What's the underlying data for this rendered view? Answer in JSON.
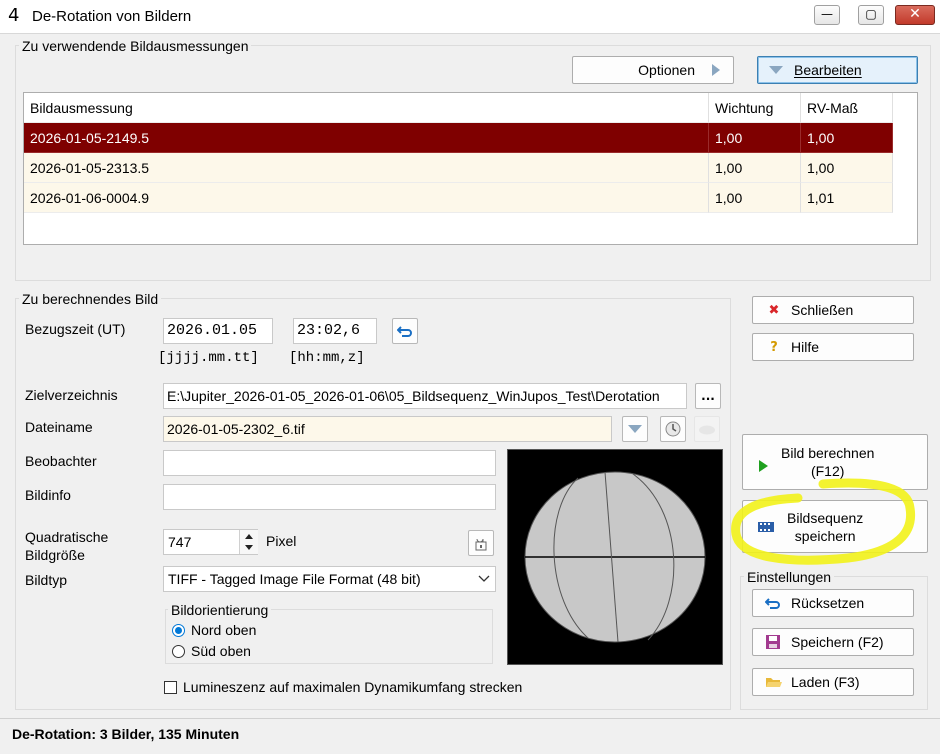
{
  "window": {
    "title": "De-Rotation von Bildern",
    "icon_glyph": "4",
    "minimize_glyph": "—",
    "maximize_glyph": "▢",
    "close_glyph": "✕"
  },
  "measurements": {
    "group_label": "Zu verwendende Bildausmessungen",
    "options_label": "Optionen",
    "edit_label": "Bearbeiten",
    "columns": [
      "Bildausmessung",
      "Wichtung",
      "RV-Maß"
    ],
    "rows": [
      {
        "name": "2026-01-05-2149.5",
        "weight": "1,00",
        "rv": "1,00",
        "selected": true
      },
      {
        "name": "2026-01-05-2313.5",
        "weight": "1,00",
        "rv": "1,00",
        "selected": false
      },
      {
        "name": "2026-01-06-0004.9",
        "weight": "1,00",
        "rv": "1,01",
        "selected": false
      }
    ]
  },
  "image": {
    "group_label": "Zu berechnendes Bild",
    "ref_time_label": "Bezugszeit (UT)",
    "date_value": "2026.01.05",
    "time_value": "23:02,6",
    "date_format": "[jjjj.mm.tt]",
    "time_format": "[hh:mm,z]",
    "target_dir_label": "Zielverzeichnis",
    "target_dir_value": "E:\\Jupiter_2026-01-05_2026-01-06\\05_Bildsequenz_WinJupos_Test\\Derotation",
    "browse_label": "...",
    "filename_label": "Dateiname",
    "filename_value": "2026-01-05-2302_6.tif",
    "observer_label": "Beobachter",
    "observer_value": "",
    "info_label": "Bildinfo",
    "info_value": "",
    "size_label_1": "Quadratische",
    "size_label_2": "Bildgröße",
    "size_value": "747",
    "size_unit": "Pixel",
    "type_label": "Bildtyp",
    "type_value": "TIFF - Tagged Image File Format (48 bit)",
    "orientation_label": "Bildorientierung",
    "north_label": "Nord oben",
    "south_label": "Süd oben",
    "orientation_selected": "north",
    "luminescence_label": "Lumineszenz auf maximalen Dynamikumfang strecken",
    "luminescence_checked": false
  },
  "actions": {
    "close_label": "Schließen",
    "help_label": "Hilfe",
    "compute_label_1": "Bild berechnen",
    "compute_label_2": "(F12)",
    "sequence_label_1": "Bildsequenz",
    "sequence_label_2": "speichern",
    "settings_label": "Einstellungen",
    "reset_label": "Rücksetzen",
    "save_label": "Speichern (F2)",
    "load_label": "Laden (F3)"
  },
  "status": {
    "text": "De-Rotation: 3 Bilder, 135 Minuten"
  },
  "colors": {
    "selection": "#7f0000",
    "row_bg": "#fdf8ea",
    "highlight_marker": "#f2f21a",
    "planet_fill": "#c8c8c8"
  }
}
